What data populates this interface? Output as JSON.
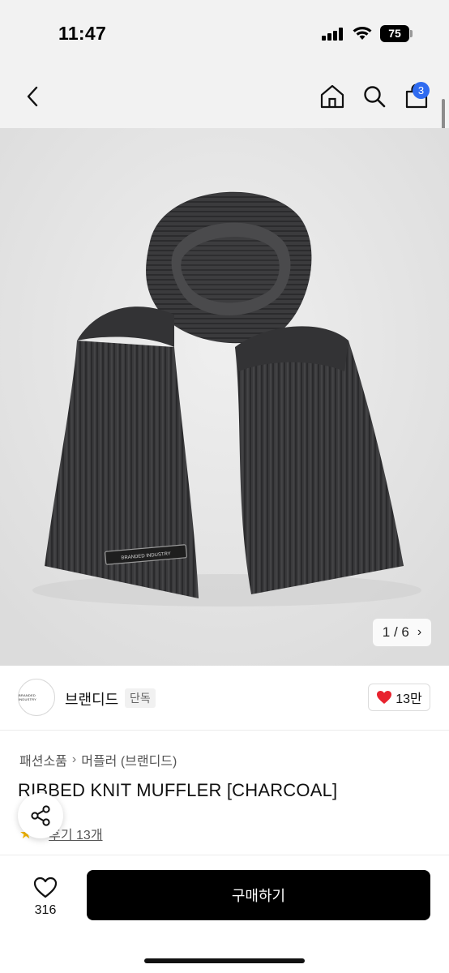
{
  "status_bar": {
    "time": "11:47",
    "battery": "75"
  },
  "nav": {
    "cart_count": "3"
  },
  "product": {
    "image_pager": {
      "text": "1 / 6"
    },
    "brand": {
      "name": "브랜디드",
      "tag": "단독",
      "logo_text": "BRANDED INDUSTRY"
    },
    "likes": "13만",
    "breadcrumb": [
      "패션소품",
      "머플러 (브랜디드)"
    ],
    "title": "RIBBED KNIT MUFFLER [CHARCOAL]",
    "review_link": "후기 13개",
    "scarf_label": "BRANDED INDUSTRY"
  },
  "bottom_bar": {
    "wish_count": "316",
    "buy_label": "구매하기"
  },
  "colors": {
    "accent_blue": "#2f6bf0",
    "heart_red": "#e8232f",
    "star_yellow": "#f5b700",
    "buy_black": "#000000"
  }
}
